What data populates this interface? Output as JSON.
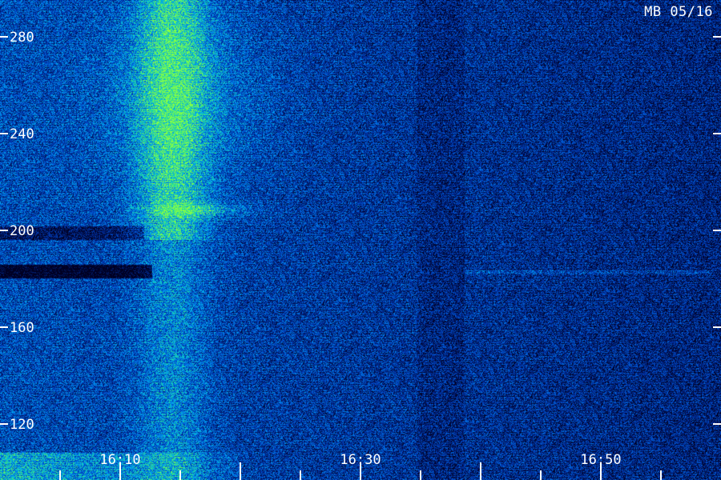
{
  "chart_data": {
    "type": "heatmap",
    "title": "MB 05/16",
    "xlabel": "",
    "ylabel": "",
    "x_ticks": [
      "16:10",
      "16:30",
      "16:50"
    ],
    "y_ticks": [
      "280",
      "240",
      "200",
      "160",
      "120"
    ],
    "xlim_minutes": [
      16.0,
      16.0
    ],
    "x_range": [
      "16:05",
      "16:55"
    ],
    "y_range": [
      105,
      285
    ],
    "colormap": [
      "#000022",
      "#001a66",
      "#0033aa",
      "#0066dd",
      "#00aaee",
      "#22dd99",
      "#88ff44"
    ],
    "grid": false
  }
}
